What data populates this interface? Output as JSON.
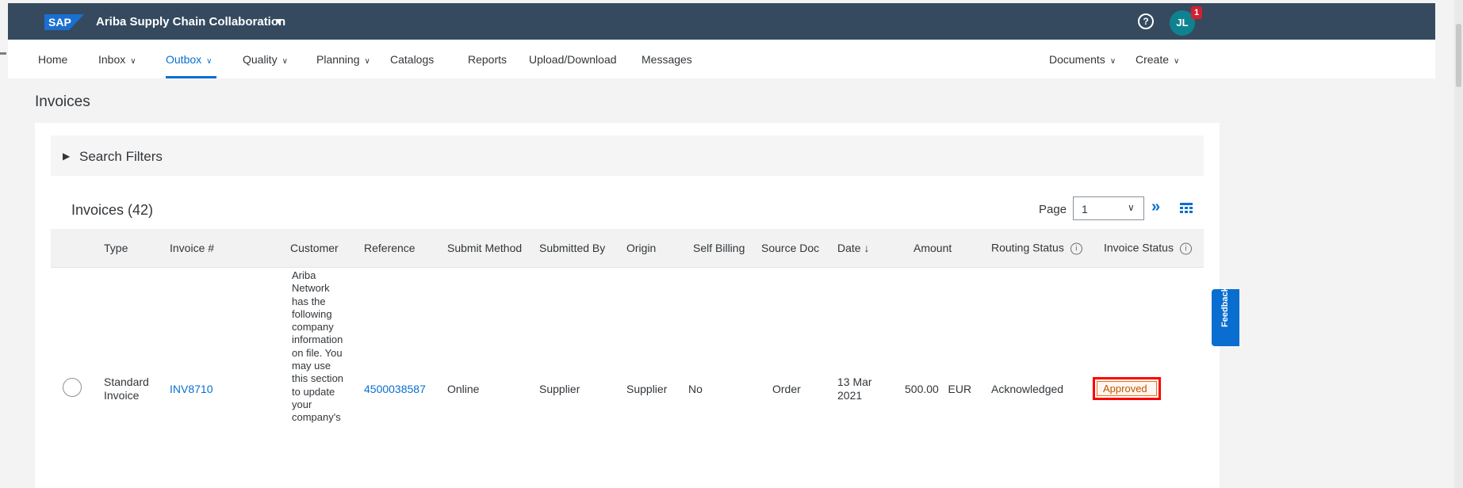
{
  "app": {
    "logo": "SAP",
    "title": "Ariba Supply Chain Collaboration",
    "help_icon": "?",
    "avatar_initials": "JL",
    "notification_count": "1"
  },
  "nav": {
    "items": [
      {
        "label": "Home",
        "dropdown": false
      },
      {
        "label": "Inbox",
        "dropdown": true
      },
      {
        "label": "Outbox",
        "dropdown": true,
        "active": true
      },
      {
        "label": "Quality",
        "dropdown": true
      },
      {
        "label": "Planning",
        "dropdown": true
      },
      {
        "label": "Catalogs",
        "dropdown": false
      },
      {
        "label": "Reports",
        "dropdown": false
      },
      {
        "label": "Upload/Download",
        "dropdown": false
      },
      {
        "label": "Messages",
        "dropdown": false
      }
    ],
    "right": [
      {
        "label": "Documents",
        "dropdown": true
      },
      {
        "label": "Create",
        "dropdown": true
      }
    ]
  },
  "page": {
    "title": "Invoices"
  },
  "filters": {
    "label": "Search Filters"
  },
  "table": {
    "title": "Invoices (42)",
    "page_label": "Page",
    "page_value": "1",
    "columns": [
      "Type",
      "Invoice #",
      "Customer",
      "Reference",
      "Submit Method",
      "Submitted By",
      "Origin",
      "Self Billing",
      "Source Doc",
      "Date",
      "Amount",
      "Routing Status",
      "Invoice Status"
    ],
    "sort_arrow": "↓",
    "rows": [
      {
        "type_line1": "Standard",
        "type_line2": "Invoice",
        "invoice": "INV8710",
        "customer_lines": [
          "Ariba",
          "Network",
          "has the",
          "following",
          "company",
          "information",
          "on file. You",
          "may use",
          "this section",
          "to update",
          "your",
          "company's"
        ],
        "reference": "4500038587",
        "submit_method": "Online",
        "submitted_by": "Supplier",
        "origin": "Supplier",
        "self_billing": "No",
        "source_doc": "Order",
        "date_line1": "13 Mar",
        "date_line2": "2021",
        "amount": "500.00",
        "currency": "EUR",
        "routing_status": "Acknowledged",
        "invoice_status": "Approved"
      }
    ]
  },
  "feedback": {
    "label": "Feedback"
  },
  "colors": {
    "shell": "#354a5f",
    "accent": "#0a6ed1",
    "highlight": "#ff0000",
    "status_border": "#e9730c"
  }
}
